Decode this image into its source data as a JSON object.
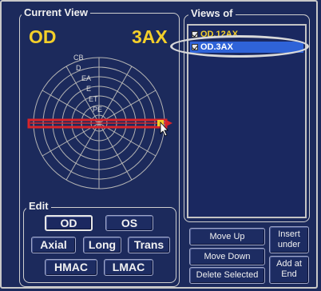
{
  "current_view": {
    "title": "Current View",
    "eye": "OD",
    "scan_type": "3AX",
    "ring_labels": [
      "CB",
      "D",
      "EA",
      "E",
      "ET",
      "PE"
    ]
  },
  "views": {
    "title": "Views of",
    "items": [
      {
        "label": "OD.12AX",
        "checked": true,
        "selected": false
      },
      {
        "label": "OD.3AX",
        "checked": true,
        "selected": true
      }
    ]
  },
  "edit": {
    "title": "Edit",
    "od": "OD",
    "os": "OS",
    "axial": "Axial",
    "long": "Long",
    "trans": "Trans",
    "hmac": "HMAC",
    "lmac": "LMAC"
  },
  "actions": {
    "move_up": "Move Up",
    "move_down": "Move Down",
    "delete_selected": "Delete Selected",
    "insert_under_1": "Insert",
    "insert_under_2": "under",
    "add_at_end_1": "Add at",
    "add_at_end_2": "End"
  },
  "colors": {
    "background": "#1c2a5c",
    "accent_yellow": "#f3cf2a",
    "selection_blue": "#2f63d8",
    "marker_red": "#d8242a"
  }
}
